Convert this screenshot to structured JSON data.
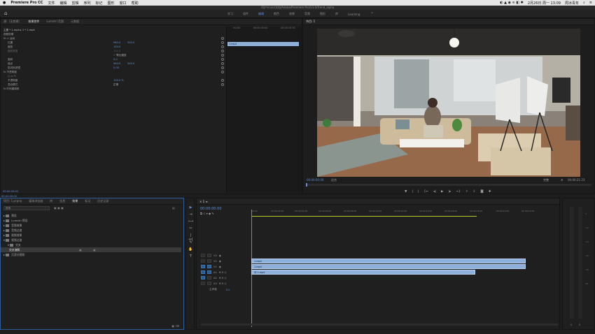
{
  "macbar": {
    "apple": "",
    "app_name": "Premiere Pro CC",
    "menus": [
      "文件",
      "编辑",
      "剪辑",
      "序列",
      "标记",
      "图形",
      "窗口",
      "帮助"
    ],
    "clock": "2月26日 周一 13:09",
    "user": "周冰青年"
  },
  "window_title": "/用户/cuie/文档/Adobe/Premiere Pro/13.0/Trend_alpha",
  "workspaces": {
    "tabs": [
      "学习",
      "组件",
      "编辑",
      "颜色",
      "效果",
      "音频",
      "图形",
      "库",
      "Learning"
    ],
    "active_index": 2,
    "more": "»"
  },
  "effect_controls": {
    "tabs": [
      "源:（无剪辑）",
      "效果控件",
      "Lumetri 范围",
      "元数据"
    ],
    "active_index": 1,
    "header": "主要 * 1.mp4  ▸  1 * 1.mp4",
    "section_video": "视频效果",
    "rows": [
      {
        "label": "fx ▭ 运动",
        "v1": "",
        "v2": ""
      },
      {
        "label": "位置",
        "v1": "960.0",
        "v2": "540.0"
      },
      {
        "label": "缩放",
        "v1": "100.0",
        "v2": ""
      },
      {
        "label": "缩放宽度",
        "v1": "100.0",
        "v2": ""
      },
      {
        "label": "",
        "v1": "✓ 等比缩放",
        "v2": ""
      },
      {
        "label": "旋转",
        "v1": "0.0",
        "v2": ""
      },
      {
        "label": "锚点",
        "v1": "960.0",
        "v2": "540.0"
      },
      {
        "label": "防闪烁滤镜",
        "v1": "0.00",
        "v2": ""
      },
      {
        "label": "fx 不透明度",
        "v1": "",
        "v2": ""
      },
      {
        "label": "○ ▭ ✎",
        "v1": "",
        "v2": ""
      },
      {
        "label": "不透明度",
        "v1": "100.0 %",
        "v2": ""
      },
      {
        "label": "混合模式",
        "v1": "正常",
        "v2": ""
      },
      {
        "label": "fx 时间重映射",
        "v1": "",
        "v2": ""
      }
    ],
    "clip_times": [
      "00:00",
      "00:00:05:00",
      "00:00:10:00"
    ],
    "clip_label": "1.mp4",
    "timecode": "00:00:00:00"
  },
  "program": {
    "tab_label": "节目: 1",
    "timecode": "00:00:00:00",
    "fit": "适合",
    "quality": "完整",
    "duration": "00:00:21:23"
  },
  "project": {
    "tabs": [
      "项目: 1.prproj",
      "媒体浏览器",
      "库",
      "信息",
      "效果",
      "标记",
      "历史记录"
    ],
    "active_index": 4,
    "search_placeholder": "搜索",
    "items": [
      "预设",
      "Lumetri 预设",
      "音频效果",
      "音频过渡",
      "视频效果",
      "视频过渡",
      "交叉",
      "交叉溶解",
      "溶解",
      "擦除",
      "缩放",
      "沉浸式视频"
    ],
    "timecode_top": "00:00:00:00"
  },
  "timeline": {
    "tab": "× 1 ≡",
    "timecode": "00:00:00:00",
    "ruler": [
      "00:00",
      "00:00:02:00",
      "00:00:04:00",
      "00:00:06:00",
      "00:00:08:00",
      "00:00:10:00",
      "00:00:12:00",
      "00:00:14:00",
      "00:00:16:00",
      "00:00:18:00",
      "00:00:20:00",
      "00:00:22:00"
    ],
    "tracks": [
      {
        "name": "V3",
        "clip": ""
      },
      {
        "name": "V2",
        "clip": "1.mp4"
      },
      {
        "name": "V1",
        "clip": "1.mp4"
      },
      {
        "name": "A1",
        "clip": "Ⓜ 1.mp4"
      },
      {
        "name": "A2",
        "clip": ""
      },
      {
        "name": "A3",
        "clip": ""
      },
      {
        "name": "主声道",
        "clip": "0.0"
      }
    ]
  },
  "meter": {
    "labels": [
      "S",
      "S"
    ],
    "scale": [
      "0",
      "-12",
      "-24",
      "-36",
      "-48",
      "dB"
    ]
  }
}
